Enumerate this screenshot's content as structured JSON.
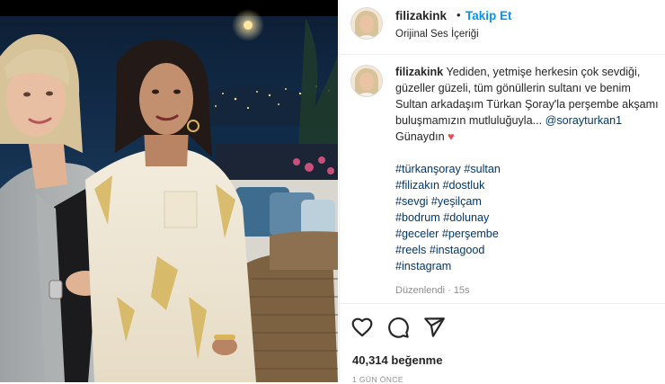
{
  "post": {
    "username": "filizakink",
    "separator": "•",
    "follow_label": "Takip Et",
    "audio_label": "Orijinal Ses İçeriği"
  },
  "caption": {
    "username": "filizakink",
    "line1": "Yediden, yetmişe herkesin çok sevdiği,",
    "line2": "güzeller güzeli, tüm gönüllerin sultanı ve benim",
    "line3": "Sultan arkadaşım Türkan Şoray'la perşembe akşamı",
    "line4": "buluşmamızın mutluluğuyla...",
    "mention": "@sorayturkan1",
    "line5": "Günaydın",
    "heart": "♥",
    "hashtag_lines": [
      [
        "#türkanşoray",
        "#sultan"
      ],
      [
        "#filizakın",
        "#dostluk"
      ],
      [
        "#sevgi",
        "#yeşilçam"
      ],
      [
        "#bodrum",
        "#dolunay"
      ],
      [
        "#geceler",
        "#perşembe"
      ],
      [
        "#reels",
        "#instagood"
      ],
      [
        "#instagram"
      ]
    ],
    "edited": "Düzenlendi · 15s"
  },
  "actions": {
    "icons": [
      "heart-icon",
      "comment-icon",
      "share-icon"
    ],
    "likes": "40,314 beğenme",
    "time": "1 GÜN ÖNCE"
  },
  "colors": {
    "link": "#0095f6",
    "hashtag": "#00376b",
    "heart": "#ed4956",
    "text": "#262626",
    "muted": "#8e8e8e"
  }
}
